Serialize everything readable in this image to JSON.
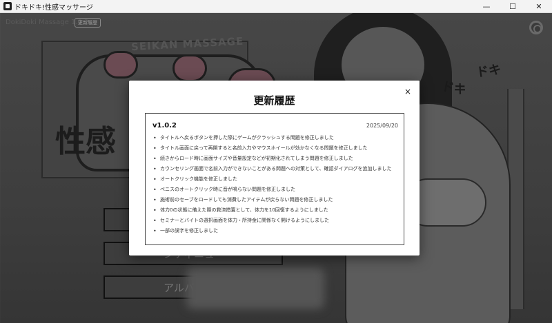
{
  "window": {
    "title": "ドキドキ!性感マッサージ",
    "controls": {
      "minimize": "—",
      "maximize": "☐",
      "close": "✕"
    }
  },
  "game": {
    "version_label": "DokiDoki Massage 1.0.2",
    "update_badge": "更新履歴",
    "logo": {
      "subtitle": "SEIKAN MASSAGE",
      "main_text": "性感",
      "deco_text": "ドキ"
    },
    "menu_buttons": [
      {
        "label": ""
      },
      {
        "label": "ンティニュー"
      },
      {
        "label": "アルバム"
      }
    ],
    "settings_icon": "gear-icon"
  },
  "modal": {
    "title": "更新履歴",
    "close_label": "×",
    "entries": [
      {
        "version": "v1.0.2",
        "date": "2025/09/20",
        "items": [
          "タイトルへ戻るボタンを押した際にゲームがクラッシュする問題を修正しました",
          "タイトル画面に戻って再開すると名前入力やマウスホイールが効かなくなる問題を修正しました",
          "続きからロード時に画面サイズや音量設定などが初期化されてしまう問題を修正しました",
          "カウンセリング画面で名前入力ができないことがある問題への対策として、確認ダイアログを追加しました",
          "オートクリック機能を修正しました",
          "ペニスのオートクリック時に音が鳴らない問題を修正しました",
          "施術前のセーブをロードしても消費したアイテムが戻らない問題を修正しました",
          "体力0の状態に備えた際の救済措置として、体力を10回復するようにしました",
          "セミナーとバイトの選択画面を体力・所持金に関係なく開けるようにしました",
          "一部の誤字を修正しました"
        ]
      }
    ]
  }
}
